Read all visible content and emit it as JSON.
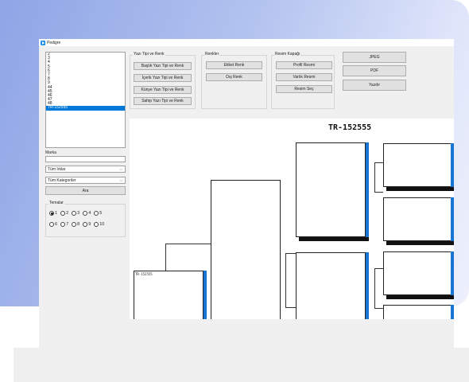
{
  "window": {
    "title": "Pedigre"
  },
  "animal_list": {
    "items": [
      "2",
      "3",
      "4",
      "5",
      "6",
      "7",
      "8",
      "9",
      "44",
      "45",
      "46",
      "47",
      "48",
      "TR-152555"
    ],
    "selected_index": 13
  },
  "filters": {
    "brand_label": "Marka",
    "brand_value": "",
    "breed_select": "Tüm Irklar",
    "category_select": "Tüm Kategoriler",
    "search_button": "Ara"
  },
  "themes": {
    "title": "Temalar",
    "options": [
      "1",
      "2",
      "3",
      "4",
      "5",
      "6",
      "7",
      "8",
      "9",
      "10"
    ],
    "selected": "1"
  },
  "font_group": {
    "title": "Yazı Tipi ve Renk",
    "buttons": [
      "Başlık Yazı Tipi ve Renk",
      "İçerik Yazı Tipi ve Renk",
      "Künye Yazı Tipi ve Renk",
      "Sahip Yazı Tipi ve Renk"
    ]
  },
  "color_group": {
    "title": "Renkler",
    "buttons": [
      "Etiket Renk",
      "Dış Renk"
    ]
  },
  "cover_group": {
    "title": "Resim Kapağı",
    "buttons": [
      "Profil Resmi",
      "Varlık Resmi",
      "Resim Seç"
    ]
  },
  "export": {
    "jpeg": "JPEG",
    "pdf": "PDF",
    "print": "Yazdır"
  },
  "pedigree": {
    "title": "TR-152555",
    "root_label": "TR-152555",
    "colors": {
      "edge_blue": "#1a74d4",
      "edge_black": "#111111"
    }
  }
}
